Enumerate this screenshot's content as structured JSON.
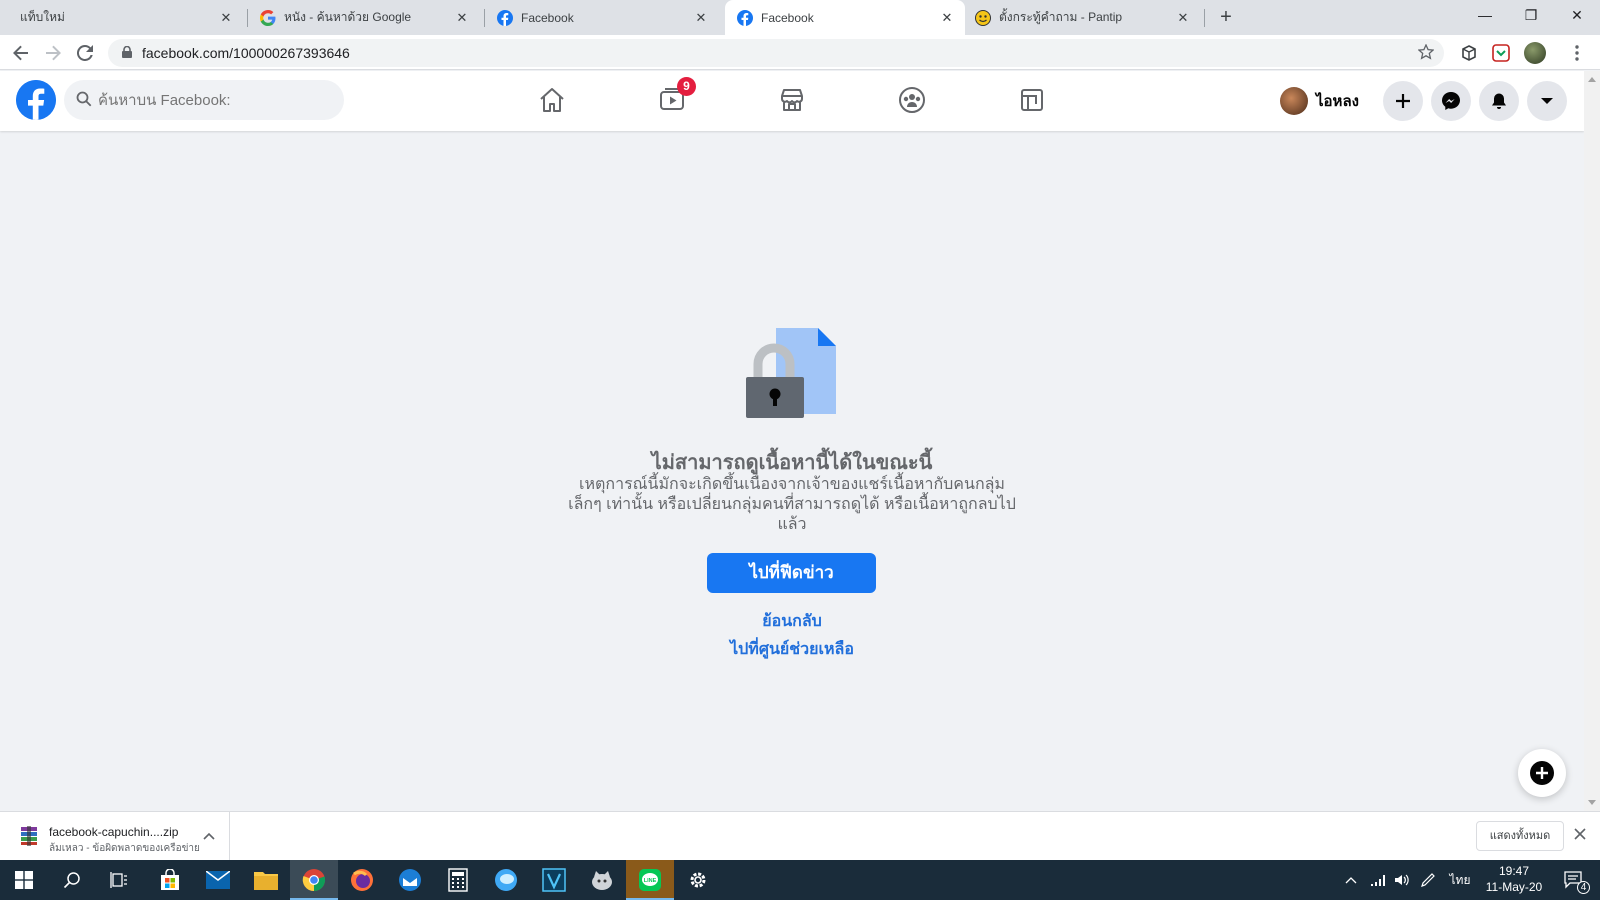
{
  "browser": {
    "tabs": [
      {
        "title": "แท็บใหม่",
        "favicon": "none"
      },
      {
        "title": "หนัง - ค้นหาด้วย Google",
        "favicon": "google-icon"
      },
      {
        "title": "Facebook",
        "favicon": "facebook-icon"
      },
      {
        "title": "Facebook",
        "favicon": "facebook-icon",
        "active": true
      },
      {
        "title": "ตั้งกระทู้คำถาม - Pantip",
        "favicon": "pantip-icon"
      }
    ],
    "url": "facebook.com/100000267393646"
  },
  "fb": {
    "search_placeholder": "ค้นหาบน Facebook:",
    "watch_badge": "9",
    "profile_name": "ไอหลง",
    "brand_color": "#1877f2"
  },
  "error": {
    "title": "ไม่สามารถดูเนื้อหานี้ได้ในขณะนี้",
    "body": "เหตุการณ์นี้มักจะเกิดขึ้นเนื่องจากเจ้าของแชร์เนื้อหากับคนกลุ่มเล็กๆ เท่านั้น หรือเปลี่ยนกลุ่มคนที่สามารถดูได้ หรือเนื้อหาถูกลบไปแล้ว",
    "primary_button": "ไปที่ฟีดข่าว",
    "back_link": "ย้อนกลับ",
    "help_link": "ไปที่ศูนย์ช่วยเหลือ"
  },
  "download": {
    "filename": "facebook-capuchin....zip",
    "status": "ล้มเหลว - ข้อผิดพลาดของเครือข่าย",
    "show_all": "แสดงทั้งหมด"
  },
  "taskbar": {
    "language": "ไทย",
    "time": "19:47",
    "date": "11-May-20",
    "notifications": "4"
  }
}
